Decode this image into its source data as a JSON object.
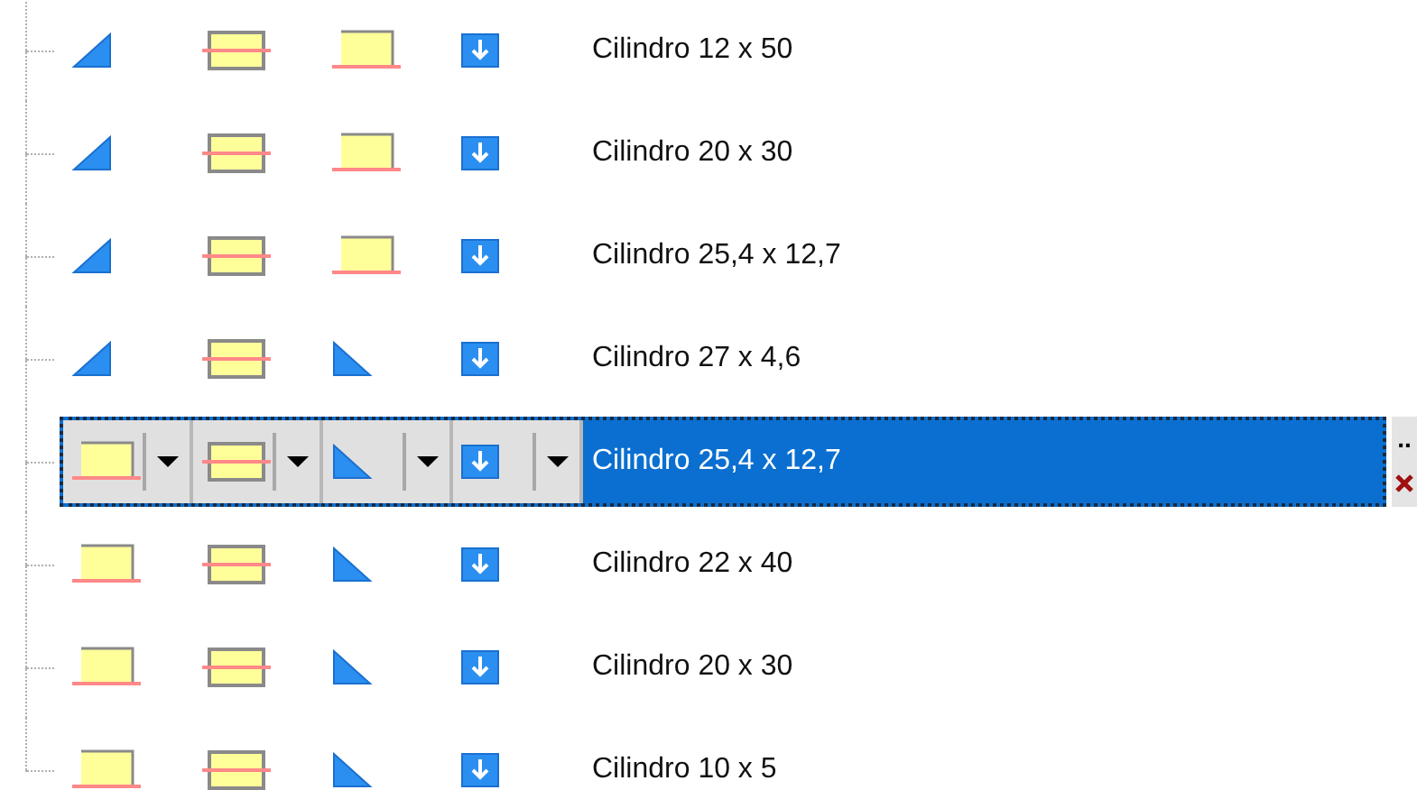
{
  "rows": [
    {
      "label": "Cilindro 12 x 50",
      "selected": false,
      "icons": [
        {
          "kind": "ramp"
        },
        {
          "kind": "box-mid"
        },
        {
          "kind": "box-bottom"
        },
        {
          "kind": "download"
        }
      ]
    },
    {
      "label": "Cilindro 20 x 30",
      "selected": false,
      "icons": [
        {
          "kind": "ramp"
        },
        {
          "kind": "box-mid"
        },
        {
          "kind": "box-bottom"
        },
        {
          "kind": "download"
        }
      ]
    },
    {
      "label": "Cilindro 25,4 x 12,7",
      "selected": false,
      "icons": [
        {
          "kind": "ramp"
        },
        {
          "kind": "box-mid"
        },
        {
          "kind": "box-bottom"
        },
        {
          "kind": "download"
        }
      ]
    },
    {
      "label": "Cilindro 27 x 4,6",
      "selected": false,
      "icons": [
        {
          "kind": "ramp"
        },
        {
          "kind": "box-mid"
        },
        {
          "kind": "drop"
        },
        {
          "kind": "download"
        }
      ]
    },
    {
      "label": "Cilindro 25,4 x 12,7",
      "selected": true,
      "icons": [
        {
          "kind": "box-bottom"
        },
        {
          "kind": "box-mid"
        },
        {
          "kind": "drop"
        },
        {
          "kind": "download"
        }
      ]
    },
    {
      "label": "Cilindro 22 x 40",
      "selected": false,
      "icons": [
        {
          "kind": "box-bottom"
        },
        {
          "kind": "box-mid"
        },
        {
          "kind": "drop"
        },
        {
          "kind": "download"
        }
      ]
    },
    {
      "label": "Cilindro 20 x 30",
      "selected": false,
      "icons": [
        {
          "kind": "box-bottom"
        },
        {
          "kind": "box-mid"
        },
        {
          "kind": "drop"
        },
        {
          "kind": "download"
        }
      ]
    },
    {
      "label": "Cilindro 10 x 5",
      "selected": false,
      "icons": [
        {
          "kind": "box-bottom"
        },
        {
          "kind": "box-mid"
        },
        {
          "kind": "drop"
        },
        {
          "kind": "download"
        }
      ]
    }
  ],
  "editor": {
    "more_button": ".."
  }
}
